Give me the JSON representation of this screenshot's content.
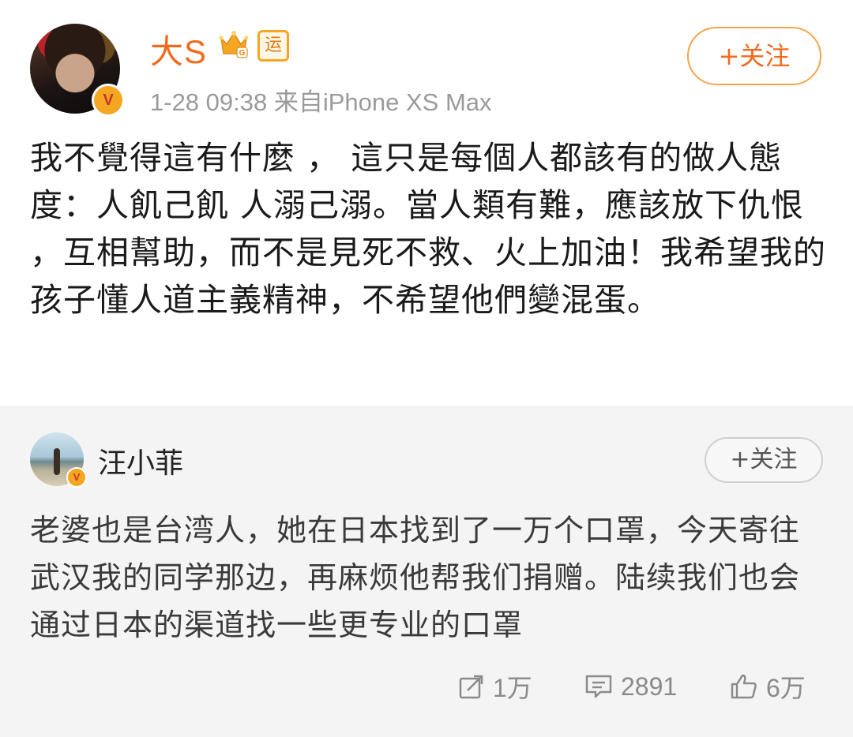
{
  "post": {
    "author": "大S",
    "yun_badge": "运",
    "crown_letter": "G",
    "verified_mark": "V",
    "timestamp": "1-28 09:38",
    "source": "来自iPhone XS Max",
    "follow_label": "+关注",
    "text": "我不覺得這有什麼 ， 這只是每個人都該有的做人態度：人飢己飢 人溺己溺。當人類有難，應該放下仇恨 ，互相幫助，而不是見死不救、火上加油！我希望我的孩子懂人道主義精神，不希望他們變混蛋。"
  },
  "comment": {
    "author": "汪小菲",
    "verified_mark": "V",
    "follow_label": "+关注",
    "text": "老婆也是台湾人，她在日本找到了一万个口罩，今天寄往武汉我的同学那边，再麻烦他帮我们捐赠。陆续我们也会通过日本的渠道找一些更专业的口罩"
  },
  "actions": {
    "repost_count": "1万",
    "comment_count": "2891",
    "like_count": "6万"
  },
  "colors": {
    "author_orange": "#f26b1d",
    "badge_gold": "#f5a623",
    "meta_gray": "#9a9a9a",
    "comment_bg": "#f4f4f4"
  }
}
